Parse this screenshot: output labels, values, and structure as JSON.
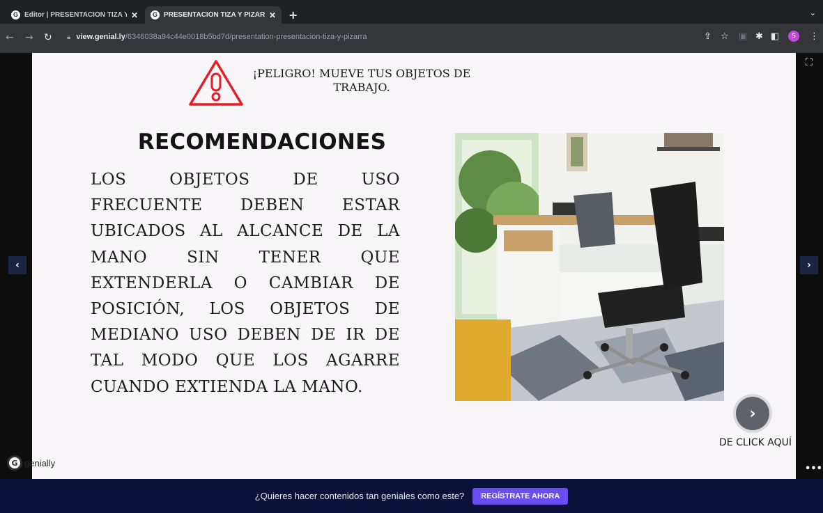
{
  "browser": {
    "tabs": [
      {
        "title": "Editor | PRESENTACIÓN TIZA Y",
        "active": false
      },
      {
        "title": "PRESENTACIÓN TIZA Y PIZARR",
        "active": true
      }
    ],
    "url_host": "view.genial.ly",
    "url_path": "/6346038a94c44e0018b5bd7d/presentation-presentacion-tiza-y-pizarra",
    "profile_initial": "S"
  },
  "slide": {
    "warning_text": "¡PELIGRO! MUEVE TUS OBJETOS DE TRABAJO.",
    "heading": "RECOMENDACIONES",
    "body": "LOS OBJETOS DE USO FRECUENTE DEBEN ESTAR UBICADOS AL ALCANCE DE LA MANO SIN TENER QUE EXTENDERLA O CAMBIAR DE POSICIÓN, LOS OBJETOS DE MEDIANO USO DEBEN DE IR DE TAL MODO QUE LOS AGARRE CUANDO EXTIENDA LA MANO.",
    "click_label": "DE CLICK AQUÍ"
  },
  "brand": {
    "name": "genially"
  },
  "banner": {
    "question": "¿Quieres hacer contenidos tan geniales como este?",
    "cta": "REGÍSTRATE AHORA"
  },
  "colors": {
    "warning_red": "#e31e24",
    "cta_purple": "#6a4df0",
    "banner_bg": "#0b1138"
  }
}
